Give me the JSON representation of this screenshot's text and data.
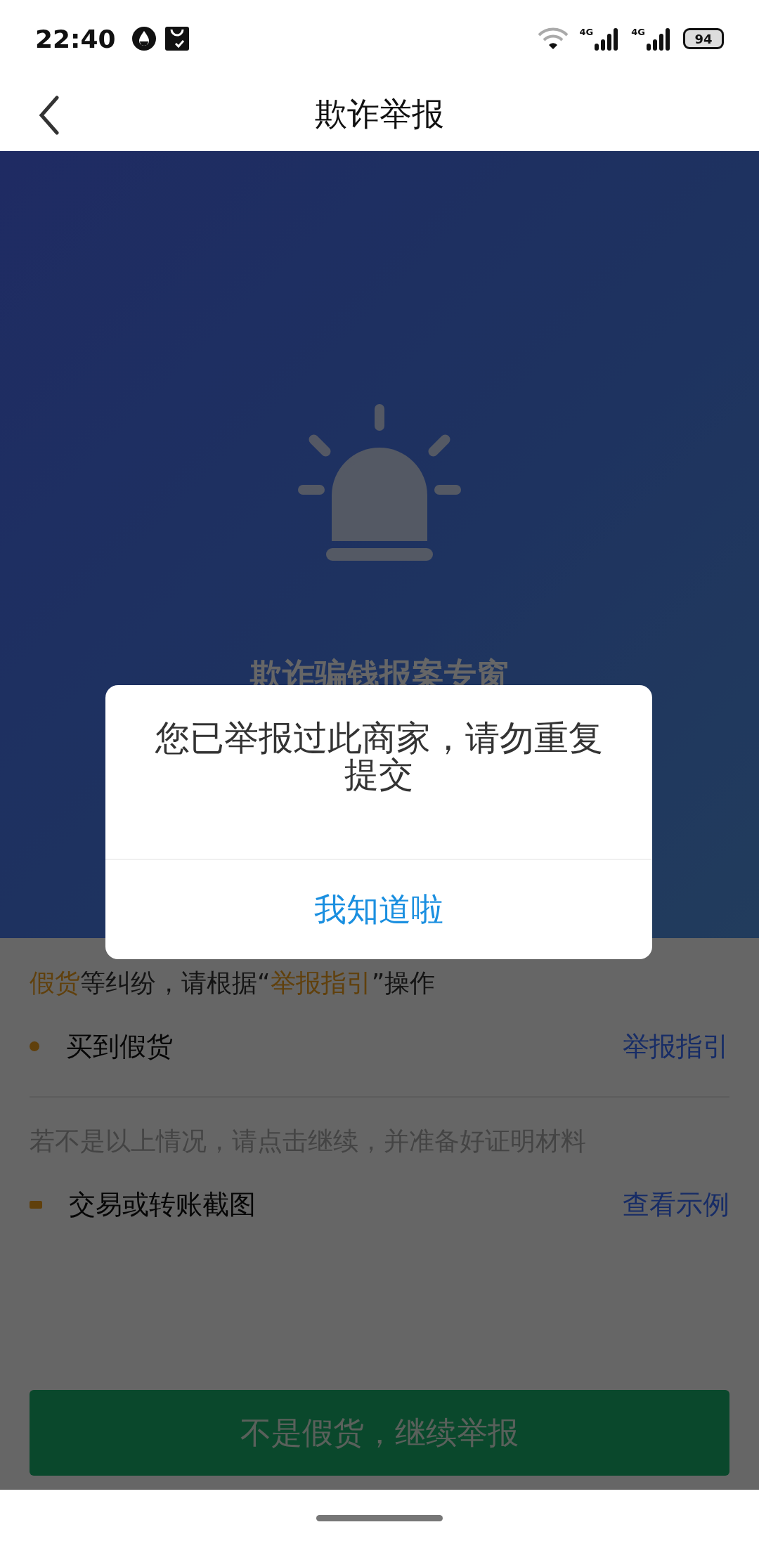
{
  "status_bar": {
    "time": "22:40",
    "network_labels": [
      "4G",
      "4G"
    ],
    "battery": "94"
  },
  "nav": {
    "title": "欺诈举报"
  },
  "hero": {
    "title": "欺诈骗钱报案专窗"
  },
  "notice": [
    {
      "text": "假货",
      "highlight": true
    },
    {
      "text": "等纠纷，请根据“",
      "highlight": false
    },
    {
      "text": "举报指引",
      "highlight": true
    },
    {
      "text": "”操作",
      "highlight": false
    }
  ],
  "items_top": [
    {
      "kind": "dot",
      "label": "买到假货",
      "link": "举报指引"
    }
  ],
  "hint": "若不是以上情况，请点击继续，并准备好证明材料",
  "items_bottom": [
    {
      "kind": "square",
      "label": "交易或转账截图",
      "link": "查看示例"
    }
  ],
  "primary_button": "不是假货，继续举报",
  "dialog": {
    "message": "您已举报过此商家，请勿重复提交",
    "button": "我知道啦"
  }
}
